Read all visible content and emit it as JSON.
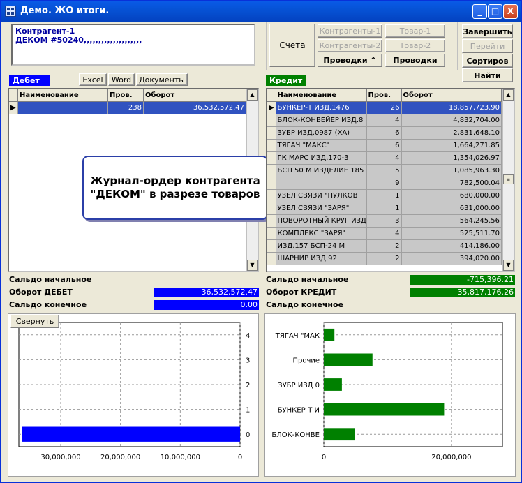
{
  "window": {
    "title": "Демо. ЖО итоги.",
    "minimize": "_",
    "maximize": "□",
    "close": "X"
  },
  "memo": {
    "line1": "Контрагент-1",
    "line2": "ДЕКОМ #50240,,,,,,,,,,,,,,,,,,,,"
  },
  "toolbar": {
    "accounts": "Счета",
    "contractors1": "Контрагенты-1",
    "contractors2": "Контрагенты-2",
    "goods1": "Товар-1",
    "goods2": "Товар-2",
    "postings_sort": "Проводки ^",
    "postings": "Проводки",
    "finish": "Завершить",
    "goto": "Перейти",
    "sort": "Сортиров",
    "find": "Найти"
  },
  "debit": {
    "tag": "Дебет",
    "excel": "Excel",
    "word": "Word",
    "docs": "Документы",
    "columns": [
      "Наименование",
      "Пров.",
      "Оборот"
    ],
    "rows": [
      {
        "name": "",
        "count": "238",
        "turnover": "36,532,572.47"
      }
    ],
    "start_balance_label": "Сальдо начальное",
    "turnover_label": "Оборот ДЕБЕТ",
    "turnover_value": "36,532,572.47",
    "end_balance_label": "Сальдо конечное",
    "end_balance_value": "0.00",
    "color": "#0000ff"
  },
  "credit": {
    "tag": "Кредит",
    "columns": [
      "Наименование",
      "Пров.",
      "Оборот"
    ],
    "rows": [
      {
        "name": "БУНКЕР-Т ИЗД.1476",
        "count": "26",
        "turnover": "18,857,723.90"
      },
      {
        "name": "БЛОК-КОНВЕЙЕР ИЗД.8",
        "count": "4",
        "turnover": "4,832,704.00"
      },
      {
        "name": "ЗУБР ИЗД.0987 (ХА)",
        "count": "6",
        "turnover": "2,831,648.10"
      },
      {
        "name": "ТЯГАЧ \"МАКС\"",
        "count": "6",
        "turnover": "1,664,271.85"
      },
      {
        "name": "ГК МАРС ИЗД.170-3",
        "count": "4",
        "turnover": "1,354,026.97"
      },
      {
        "name": "БСП 50 М ИЗДЕЛИЕ 185",
        "count": "5",
        "turnover": "1,085,963.30"
      },
      {
        "name": "",
        "count": "9",
        "turnover": "782,500.04"
      },
      {
        "name": "УЗЕЛ СВЯЗИ \"ПУЛКОВ",
        "count": "1",
        "turnover": "680,000.00"
      },
      {
        "name": "УЗЕЛ СВЯЗИ \"ЗАРЯ\"",
        "count": "1",
        "turnover": "631,000.00"
      },
      {
        "name": "ПОВОРОТНЫЙ КРУГ ИЗД",
        "count": "3",
        "turnover": "564,245.56"
      },
      {
        "name": "КОМПЛЕКС \"ЗАРЯ\"",
        "count": "4",
        "turnover": "525,511.70"
      },
      {
        "name": "ИЗД.157 БСП-24 М",
        "count": "2",
        "turnover": "414,186.00"
      },
      {
        "name": "ШАРНИР ИЗД.92",
        "count": "2",
        "turnover": "394,020.00"
      }
    ],
    "start_balance_label": "Сальдо начальное",
    "start_balance_value": "-715,396.21",
    "turnover_label": "Оборот КРЕДИТ",
    "turnover_value": "35,817,176.26",
    "end_balance_label": "Сальдо конечное",
    "color": "#008000"
  },
  "callout": {
    "line1": "Журнал-ордер контрагента",
    "line2": "\"ДЕКОМ\" в разрезе товаров"
  },
  "collapse_button": "Свернуть",
  "chart_data": [
    {
      "type": "bar",
      "orientation": "horizontal",
      "x_reversed": true,
      "categories": [
        "0",
        "1",
        "2",
        "3",
        "4"
      ],
      "values": [
        36532572.47,
        null,
        null,
        null,
        null
      ],
      "xlim": [
        0,
        37000000
      ],
      "xticks": [
        0,
        10000000,
        20000000,
        30000000
      ],
      "xtick_labels": [
        "0",
        "10,000,000",
        "20,000,000",
        "30,000,000"
      ],
      "ytick_labels": [
        "0",
        "1",
        "2",
        "3",
        "4"
      ],
      "color": "#0000ff",
      "grid": true
    },
    {
      "type": "bar",
      "orientation": "horizontal",
      "categories": [
        "БЛОК-КОНВЕ",
        "БУНКЕР-Т И",
        "ЗУБР ИЗД 0",
        "Прочие",
        "ТЯГАЧ \"МАК"
      ],
      "values": [
        4832704.0,
        18857723.9,
        2831648.1,
        7630000,
        1664271.85
      ],
      "xlim": [
        0,
        28000000
      ],
      "xticks": [
        0,
        20000000
      ],
      "xtick_labels": [
        "0",
        "20,000,000"
      ],
      "color": "#008000",
      "grid": true
    }
  ]
}
